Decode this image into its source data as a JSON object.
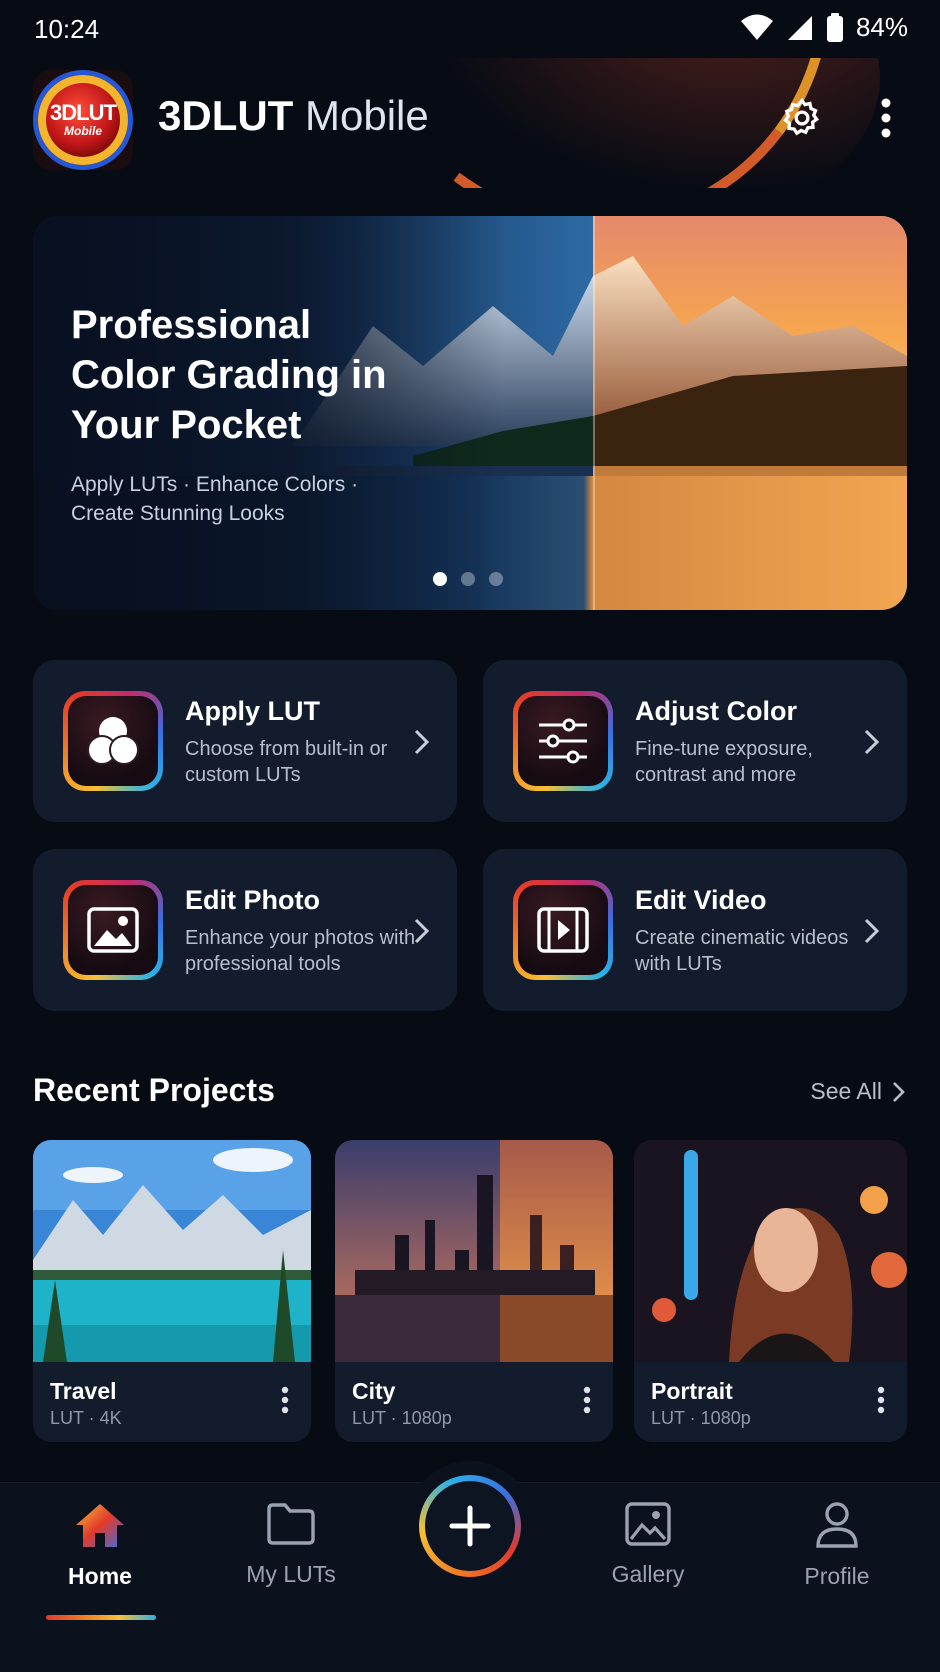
{
  "status_bar": {
    "time": "10:24",
    "battery": "84%"
  },
  "header": {
    "app_name_bold": "3DLUT",
    "app_name_light": "Mobile",
    "logo_line1": "3DLUT",
    "logo_line2": "Mobile"
  },
  "hero": {
    "title": "Professional Color Grading in Your Pocket",
    "subtitle": "Apply LUTs · Enhance Colors · Create Stunning Looks",
    "slide_count": 3,
    "active_slide": 1
  },
  "features": [
    {
      "title": "Apply LUT",
      "description": "Choose from built-in or custom LUTs",
      "icon": "lut-circles-icon"
    },
    {
      "title": "Adjust Color",
      "description": "Fine-tune exposure, contrast and more",
      "icon": "sliders-icon"
    },
    {
      "title": "Edit Photo",
      "description": "Enhance your photos with professional tools",
      "icon": "image-icon"
    },
    {
      "title": "Edit Video",
      "description": "Create cinematic videos with LUTs",
      "icon": "film-icon"
    }
  ],
  "recent": {
    "title": "Recent Projects",
    "see_all": "See All",
    "projects": [
      {
        "name": "Travel",
        "meta": "LUT · 4K"
      },
      {
        "name": "City",
        "meta": "LUT · 1080p"
      },
      {
        "name": "Portrait",
        "meta": "LUT · 1080p"
      }
    ]
  },
  "nav": {
    "items": [
      {
        "label": "Home",
        "icon": "home-icon",
        "active": true
      },
      {
        "label": "My LUTs",
        "icon": "folder-icon",
        "active": false
      },
      {
        "label": "Gallery",
        "icon": "gallery-icon",
        "active": false
      },
      {
        "label": "Profile",
        "icon": "profile-icon",
        "active": false
      }
    ],
    "fab_icon": "plus-icon"
  }
}
